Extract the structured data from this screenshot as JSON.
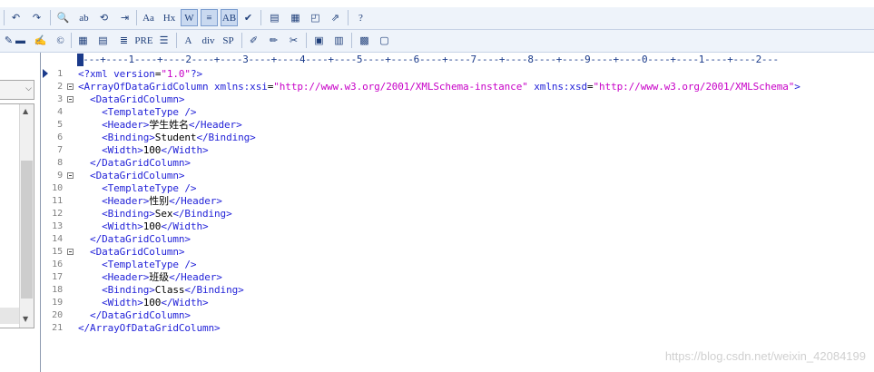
{
  "toolbar1": {
    "buttons": [
      {
        "name": "undo-icon",
        "glyph": "↶"
      },
      {
        "name": "redo-icon",
        "glyph": "↷"
      },
      {
        "name": "find-icon",
        "glyph": "🔍"
      },
      {
        "name": "spellcheck-icon",
        "glyph": "ab"
      },
      {
        "name": "replace-icon",
        "glyph": "⟲"
      },
      {
        "name": "indent-icon",
        "glyph": "⇥"
      },
      {
        "name": "font-size-icon",
        "glyph": "Aa"
      },
      {
        "name": "heading-icon",
        "glyph": "Hx"
      },
      {
        "name": "word-wrap-icon",
        "glyph": "W"
      },
      {
        "name": "line-numbers-icon",
        "glyph": "≡"
      },
      {
        "name": "sort-icon",
        "glyph": "AB"
      },
      {
        "name": "validate-icon",
        "glyph": "✔"
      },
      {
        "name": "view-list-icon",
        "glyph": "▤"
      },
      {
        "name": "view-grid-icon",
        "glyph": "▦"
      },
      {
        "name": "browser-preview-icon",
        "glyph": "◰"
      },
      {
        "name": "external-view-icon",
        "glyph": "⇗"
      },
      {
        "name": "help-icon",
        "glyph": "?"
      }
    ]
  },
  "toolbar2": {
    "buttons": [
      {
        "name": "paint-icon",
        "glyph": "✎"
      },
      {
        "name": "horizontal-rule-icon",
        "glyph": "▬"
      },
      {
        "name": "highlight-icon",
        "glyph": "✍"
      },
      {
        "name": "copyright-icon",
        "glyph": "©"
      },
      {
        "name": "table-icon",
        "glyph": "▦"
      },
      {
        "name": "form-icon",
        "glyph": "▤"
      },
      {
        "name": "align-icon",
        "glyph": "≣"
      },
      {
        "name": "preformatted-icon",
        "glyph": "PRE"
      },
      {
        "name": "bullet-list-icon",
        "glyph": "☰"
      },
      {
        "name": "anchor-icon",
        "glyph": "A"
      },
      {
        "name": "div-tag-icon",
        "glyph": "div"
      },
      {
        "name": "span-tag-icon",
        "glyph": "SP"
      },
      {
        "name": "edit-note-icon",
        "glyph": "✐"
      },
      {
        "name": "pencil-icon",
        "glyph": "✏"
      },
      {
        "name": "tools-icon",
        "glyph": "✂"
      },
      {
        "name": "panel-icon",
        "glyph": "▣"
      },
      {
        "name": "tree-icon",
        "glyph": "▥"
      },
      {
        "name": "color-icon",
        "glyph": "▩"
      },
      {
        "name": "window-icon",
        "glyph": "▢"
      }
    ]
  },
  "ruler": "----+----1----+----2----+----3----+----4----+----5----+----6----+----7----+----8----+----9----+----0----+----1----+----2---",
  "lines": [
    {
      "n": "1",
      "fold": false,
      "indent": "",
      "parts": [
        [
          "t",
          "<?xml "
        ],
        [
          "a",
          "version"
        ],
        [
          "x",
          "="
        ],
        [
          "v",
          "\"1.0\""
        ],
        [
          "t",
          "?>"
        ]
      ]
    },
    {
      "n": "2",
      "fold": true,
      "indent": "",
      "parts": [
        [
          "t",
          "<ArrayOfDataGridColumn "
        ],
        [
          "a",
          "xmlns:xsi"
        ],
        [
          "x",
          "="
        ],
        [
          "v",
          "\"http://www.w3.org/2001/XMLSchema-instance\""
        ],
        [
          "x",
          " "
        ],
        [
          "a",
          "xmlns:xsd"
        ],
        [
          "x",
          "="
        ],
        [
          "v",
          "\"http://www.w3.org/2001/XMLSchema\""
        ],
        [
          "t",
          ">"
        ]
      ]
    },
    {
      "n": "3",
      "fold": true,
      "indent": "  ",
      "parts": [
        [
          "t",
          "<DataGridColumn>"
        ]
      ]
    },
    {
      "n": "4",
      "fold": false,
      "indent": "    ",
      "parts": [
        [
          "t",
          "<TemplateType />"
        ]
      ]
    },
    {
      "n": "5",
      "fold": false,
      "indent": "    ",
      "parts": [
        [
          "t",
          "<Header>"
        ],
        [
          "x",
          "学生姓名"
        ],
        [
          "t",
          "</Header>"
        ]
      ]
    },
    {
      "n": "6",
      "fold": false,
      "indent": "    ",
      "parts": [
        [
          "t",
          "<Binding>"
        ],
        [
          "x",
          "Student"
        ],
        [
          "t",
          "</Binding>"
        ]
      ]
    },
    {
      "n": "7",
      "fold": false,
      "indent": "    ",
      "parts": [
        [
          "t",
          "<Width>"
        ],
        [
          "x",
          "100"
        ],
        [
          "t",
          "</Width>"
        ]
      ]
    },
    {
      "n": "8",
      "fold": false,
      "indent": "  ",
      "parts": [
        [
          "t",
          "</DataGridColumn>"
        ]
      ]
    },
    {
      "n": "9",
      "fold": true,
      "indent": "  ",
      "parts": [
        [
          "t",
          "<DataGridColumn>"
        ]
      ]
    },
    {
      "n": "10",
      "fold": false,
      "indent": "    ",
      "parts": [
        [
          "t",
          "<TemplateType />"
        ]
      ]
    },
    {
      "n": "11",
      "fold": false,
      "indent": "    ",
      "parts": [
        [
          "t",
          "<Header>"
        ],
        [
          "x",
          "性别"
        ],
        [
          "t",
          "</Header>"
        ]
      ]
    },
    {
      "n": "12",
      "fold": false,
      "indent": "    ",
      "parts": [
        [
          "t",
          "<Binding>"
        ],
        [
          "x",
          "Sex"
        ],
        [
          "t",
          "</Binding>"
        ]
      ]
    },
    {
      "n": "13",
      "fold": false,
      "indent": "    ",
      "parts": [
        [
          "t",
          "<Width>"
        ],
        [
          "x",
          "100"
        ],
        [
          "t",
          "</Width>"
        ]
      ]
    },
    {
      "n": "14",
      "fold": false,
      "indent": "  ",
      "parts": [
        [
          "t",
          "</DataGridColumn>"
        ]
      ]
    },
    {
      "n": "15",
      "fold": true,
      "indent": "  ",
      "parts": [
        [
          "t",
          "<DataGridColumn>"
        ]
      ]
    },
    {
      "n": "16",
      "fold": false,
      "indent": "    ",
      "parts": [
        [
          "t",
          "<TemplateType />"
        ]
      ]
    },
    {
      "n": "17",
      "fold": false,
      "indent": "    ",
      "parts": [
        [
          "t",
          "<Header>"
        ],
        [
          "x",
          "班级"
        ],
        [
          "t",
          "</Header>"
        ]
      ]
    },
    {
      "n": "18",
      "fold": false,
      "indent": "    ",
      "parts": [
        [
          "t",
          "<Binding>"
        ],
        [
          "x",
          "Class"
        ],
        [
          "t",
          "</Binding>"
        ]
      ]
    },
    {
      "n": "19",
      "fold": false,
      "indent": "    ",
      "parts": [
        [
          "t",
          "<Width>"
        ],
        [
          "x",
          "100"
        ],
        [
          "t",
          "</Width>"
        ]
      ]
    },
    {
      "n": "20",
      "fold": false,
      "indent": "  ",
      "parts": [
        [
          "t",
          "</DataGridColumn>"
        ]
      ]
    },
    {
      "n": "21",
      "fold": false,
      "indent": "",
      "parts": [
        [
          "t",
          "</ArrayOfDataGridColumn>"
        ]
      ]
    }
  ],
  "watermark": "https://blog.csdn.net/weixin_42084199",
  "colors": {
    "tag": "#2323d8",
    "value": "#c700c7",
    "text": "#000000",
    "gutter": "#808080"
  }
}
